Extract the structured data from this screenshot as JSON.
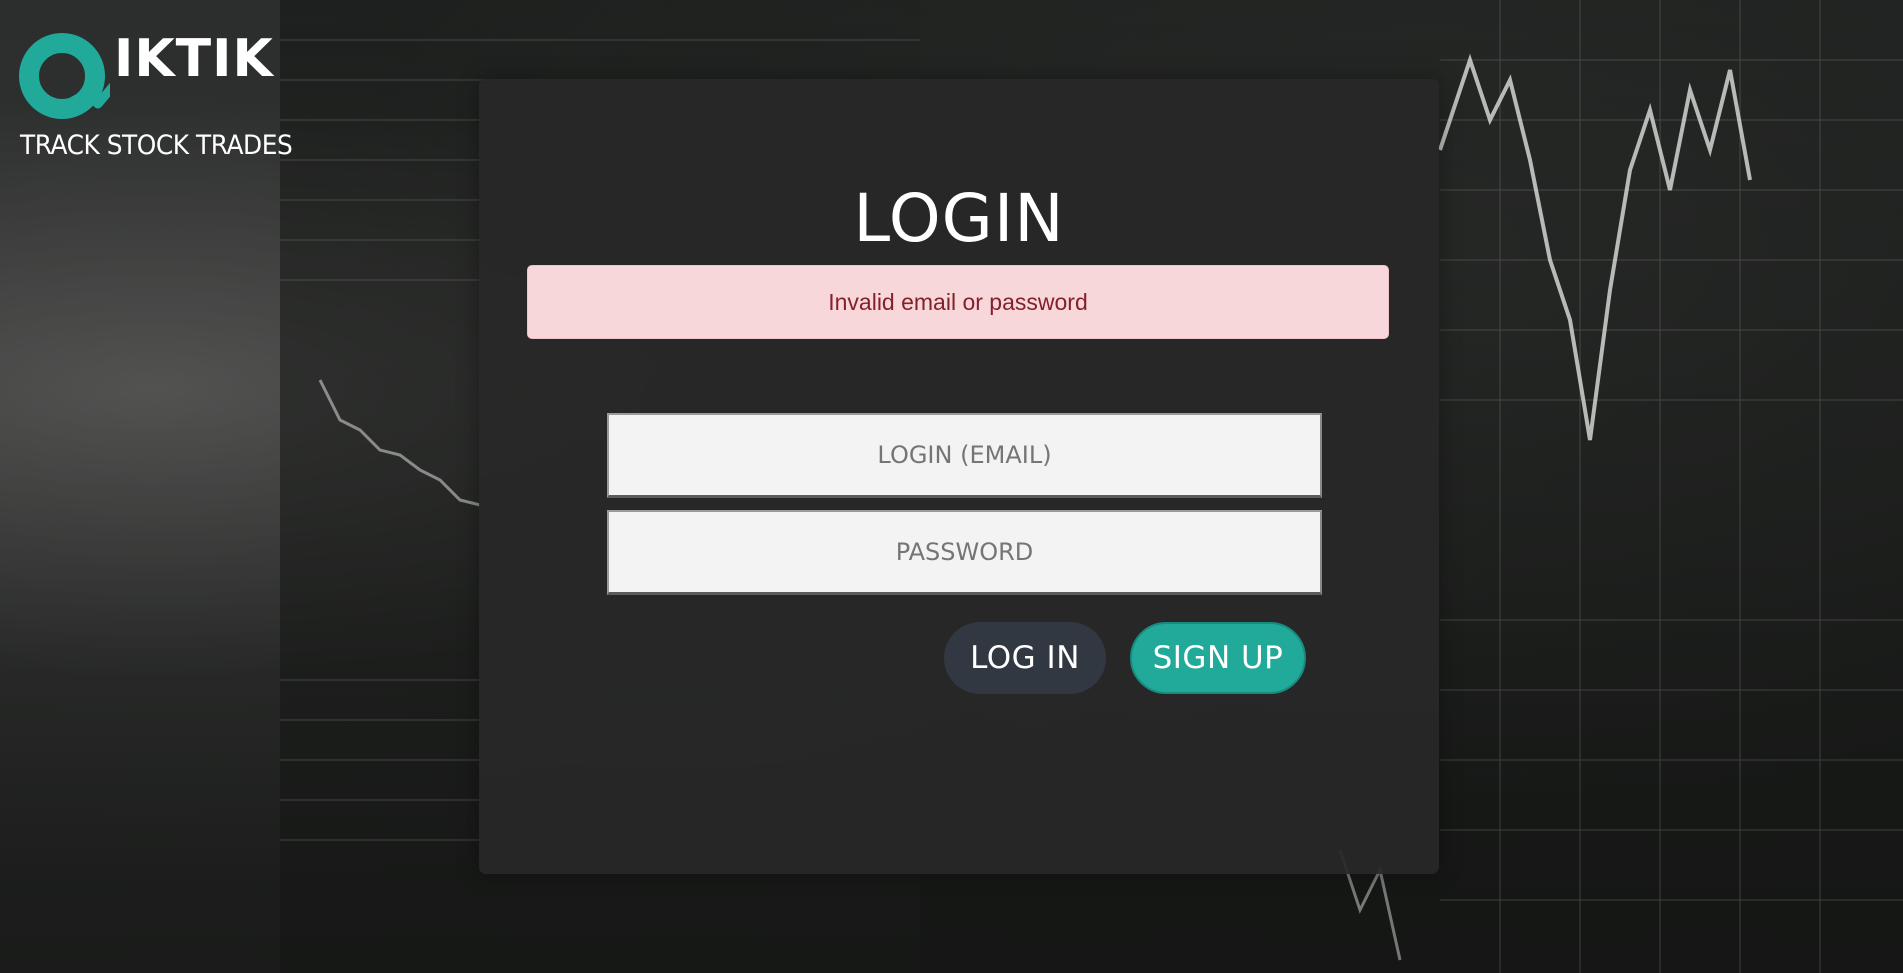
{
  "brand": {
    "wordmark": "IKTIK",
    "mark_letter": "Q",
    "tagline": "TRACK STOCK TRADES",
    "accent_color": "#21a99a",
    "logo_icon": "q-arrow-logo-icon"
  },
  "login": {
    "title": "LOGIN",
    "error_message": "Invalid email or password",
    "email_placeholder": "LOGIN (EMAIL)",
    "password_placeholder": "PASSWORD",
    "login_button": "LOG IN",
    "signup_button": "SIGN UP"
  },
  "colors": {
    "panel": "#282828",
    "alert_bg": "#f7d7da",
    "alert_text": "#842029",
    "login_button": "#323841",
    "signup_button": "#21a99a"
  }
}
